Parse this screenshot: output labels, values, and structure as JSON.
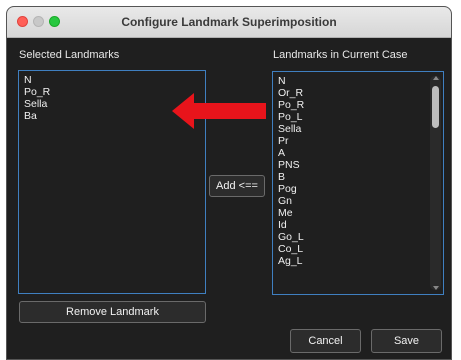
{
  "window": {
    "title": "Configure Landmark Superimposition"
  },
  "selected": {
    "label": "Selected Landmarks",
    "items": [
      "N",
      "Po_R",
      "Sella",
      "Ba"
    ]
  },
  "current": {
    "label": "Landmarks in Current Case",
    "items": [
      "N",
      "Or_R",
      "Po_R",
      "Po_L",
      "Sella",
      "Pr",
      "A",
      "PNS",
      "B",
      "Pog",
      "Gn",
      "Me",
      "Id",
      "Go_L",
      "Co_L",
      "Ag_L"
    ]
  },
  "buttons": {
    "add": "Add <==",
    "remove": "Remove Landmark",
    "cancel": "Cancel",
    "save": "Save"
  },
  "colors": {
    "annotation_arrow": "#e8141b",
    "list_border": "#3f7fc0"
  }
}
